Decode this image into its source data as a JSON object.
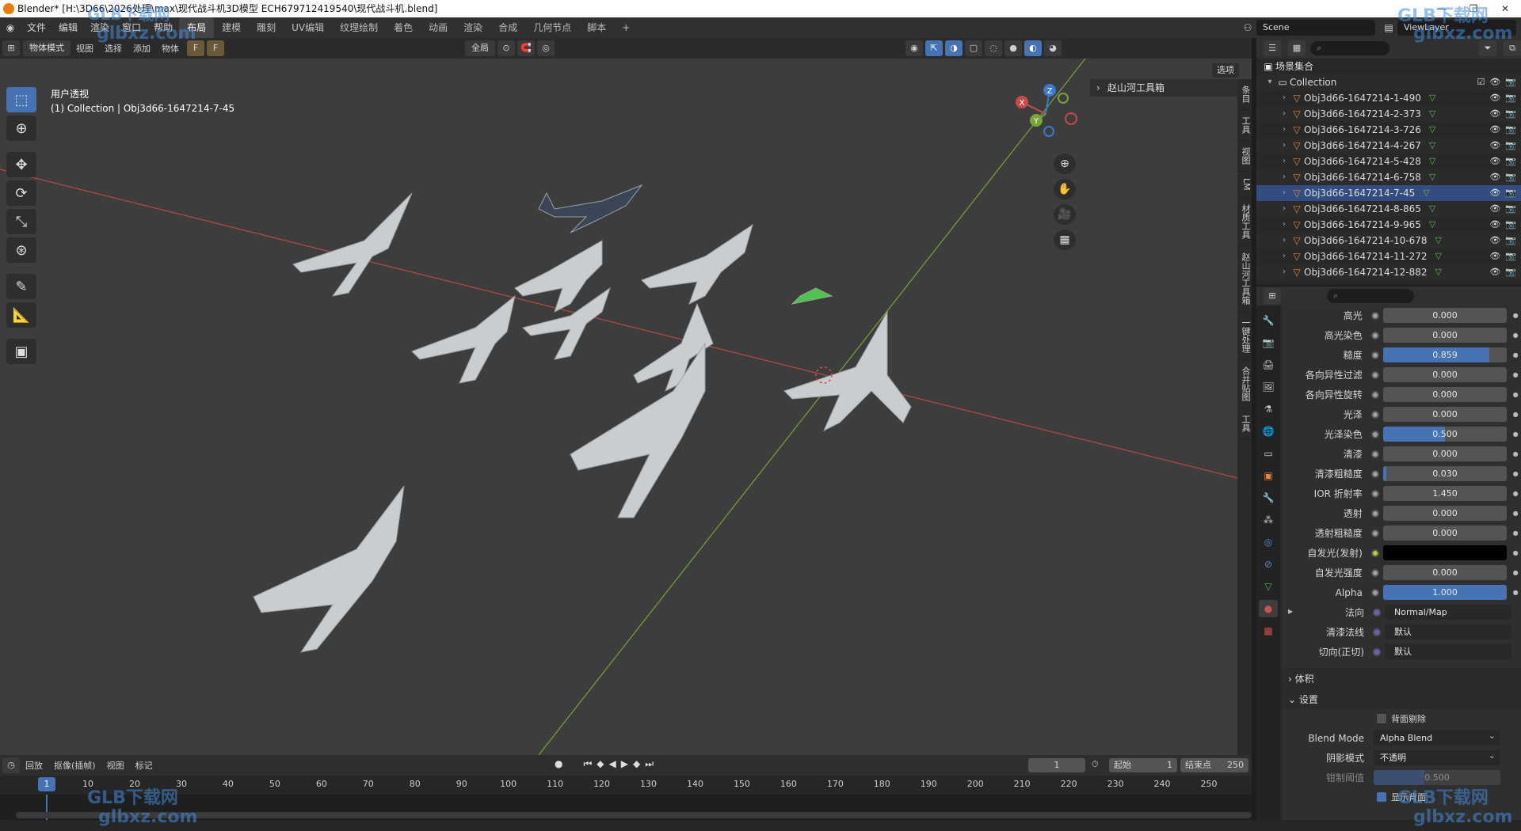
{
  "window": {
    "title": "Blender* [H:\\3D66\\2026处理\\max\\现代战斗机3D模型 ECH679712419540\\现代战斗机.blend]"
  },
  "topbar": {
    "menus": [
      "文件",
      "编辑",
      "渲染",
      "窗口",
      "帮助"
    ],
    "workspaces": [
      "布局",
      "建模",
      "雕刻",
      "UV编辑",
      "纹理绘制",
      "着色",
      "动画",
      "渲染",
      "合成",
      "几何节点",
      "脚本"
    ],
    "active_workspace": "布局",
    "add_tab": "+",
    "scene": "Scene",
    "view_layer": "ViewLayer"
  },
  "viewport_header": {
    "mode": "物体模式",
    "menus": [
      "视图",
      "选择",
      "添加",
      "物体"
    ],
    "transform_orientation": "全局",
    "options": "选项"
  },
  "viewport": {
    "view_name": "用户透视",
    "collection_info": "(1) Collection | Obj3d66-1647214-7-45",
    "n_panel_title": "赵山河工具箱",
    "n_tabs": [
      "条目",
      "工具",
      "视图",
      "LM",
      "材质工具",
      "赵山河工具箱",
      "一键处理",
      "合并贴图",
      "工具"
    ],
    "gizmo": {
      "x": "X",
      "y": "Y",
      "z": "Z"
    }
  },
  "outliner": {
    "root": "场景集合",
    "collection": "Collection",
    "objects": [
      "Obj3d66-1647214-1-490",
      "Obj3d66-1647214-2-373",
      "Obj3d66-1647214-3-726",
      "Obj3d66-1647214-4-267",
      "Obj3d66-1647214-5-428",
      "Obj3d66-1647214-6-758",
      "Obj3d66-1647214-7-45",
      "Obj3d66-1647214-8-865",
      "Obj3d66-1647214-9-965",
      "Obj3d66-1647214-10-678",
      "Obj3d66-1647214-11-272",
      "Obj3d66-1647214-12-882"
    ],
    "selected_index": 6
  },
  "properties": {
    "rows": [
      {
        "label": "高光",
        "value": "0.000",
        "fill": 0
      },
      {
        "label": "高光染色",
        "value": "0.000",
        "fill": 0
      },
      {
        "label": "糙度",
        "value": "0.859",
        "fill": 0.859
      },
      {
        "label": "各向异性过滤",
        "value": "0.000",
        "fill": 0
      },
      {
        "label": "各向异性旋转",
        "value": "0.000",
        "fill": 0
      },
      {
        "label": "光泽",
        "value": "0.000",
        "fill": 0
      },
      {
        "label": "光泽染色",
        "value": "0.500",
        "fill": 0.5
      },
      {
        "label": "清漆",
        "value": "0.000",
        "fill": 0
      },
      {
        "label": "清漆粗糙度",
        "value": "0.030",
        "fill": 0.03
      },
      {
        "label": "IOR 折射率",
        "value": "1.450",
        "fill": 0
      },
      {
        "label": "透射",
        "value": "0.000",
        "fill": 0
      },
      {
        "label": "透射粗糙度",
        "value": "0.000",
        "fill": 0
      }
    ],
    "emission_label": "自发光(发射)",
    "emission_color": "#000000",
    "emission_strength_label": "自发光强度",
    "emission_strength": "0.000",
    "alpha_label": "Alpha",
    "alpha_value": "1.000",
    "normal_label": "法向",
    "normal_value": "Normal/Map",
    "clearcoat_normal_label": "清漆法线",
    "clearcoat_normal_value": "默认",
    "tangent_label": "切向(正切)",
    "tangent_value": "默认",
    "section_volume": "体积",
    "section_settings": "设置",
    "backface_culling": "背面剔除",
    "blend_mode_label": "Blend Mode",
    "blend_mode_value": "Alpha Blend",
    "shadow_mode_label": "阴影模式",
    "shadow_mode_value": "不透明",
    "clip_threshold_label": "钳制阈值",
    "clip_threshold_value": "0.500",
    "show_backface": "显示背面"
  },
  "timeline": {
    "menus": [
      "回放",
      "抠像(插帧)",
      "视图",
      "标记"
    ],
    "current_frame": "1",
    "start_label": "起始",
    "start_value": "1",
    "end_label": "结束点",
    "end_value": "250",
    "ticks": [
      "10",
      "20",
      "30",
      "40",
      "50",
      "60",
      "70",
      "80",
      "90",
      "100",
      "110",
      "120",
      "130",
      "140",
      "150",
      "160",
      "170",
      "180",
      "190",
      "200",
      "210",
      "220",
      "230",
      "240",
      "250"
    ],
    "ruler_current": "1"
  },
  "watermark": {
    "brand": "GLB下载网",
    "url": "glbxz.com"
  },
  "colors": {
    "accent": "#4772b3",
    "x_axis": "#c84a4a",
    "y_axis": "#7aa33a",
    "z_axis": "#3a7ad0"
  }
}
